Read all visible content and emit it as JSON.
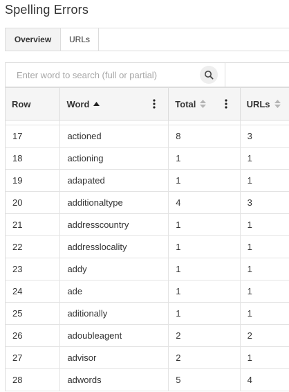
{
  "page": {
    "title": "Spelling Errors"
  },
  "tabs": [
    {
      "label": "Overview",
      "active": true
    },
    {
      "label": "URLs",
      "active": false
    }
  ],
  "search": {
    "placeholder": "Enter word to search (full or partial)",
    "value": ""
  },
  "table": {
    "columns": [
      {
        "label": "Row",
        "sort": "none"
      },
      {
        "label": "Word",
        "sort": "ascending"
      },
      {
        "label": "Total",
        "sort": "sortable"
      },
      {
        "label": "URLs",
        "sort": "sortable"
      }
    ],
    "rows": [
      {
        "row": "17",
        "word": "actioned",
        "total": "8",
        "urls": "3"
      },
      {
        "row": "18",
        "word": "actioning",
        "total": "1",
        "urls": "1"
      },
      {
        "row": "19",
        "word": "adapated",
        "total": "1",
        "urls": "1"
      },
      {
        "row": "20",
        "word": "additionaltype",
        "total": "4",
        "urls": "3"
      },
      {
        "row": "21",
        "word": "addresscountry",
        "total": "1",
        "urls": "1"
      },
      {
        "row": "22",
        "word": "addresslocality",
        "total": "1",
        "urls": "1"
      },
      {
        "row": "23",
        "word": "addy",
        "total": "1",
        "urls": "1"
      },
      {
        "row": "24",
        "word": "ade",
        "total": "1",
        "urls": "1"
      },
      {
        "row": "25",
        "word": "aditionally",
        "total": "1",
        "urls": "1"
      },
      {
        "row": "26",
        "word": "adoubleagent",
        "total": "2",
        "urls": "2"
      },
      {
        "row": "27",
        "word": "advisor",
        "total": "2",
        "urls": "1"
      },
      {
        "row": "28",
        "word": "adwords",
        "total": "5",
        "urls": "4"
      }
    ]
  }
}
